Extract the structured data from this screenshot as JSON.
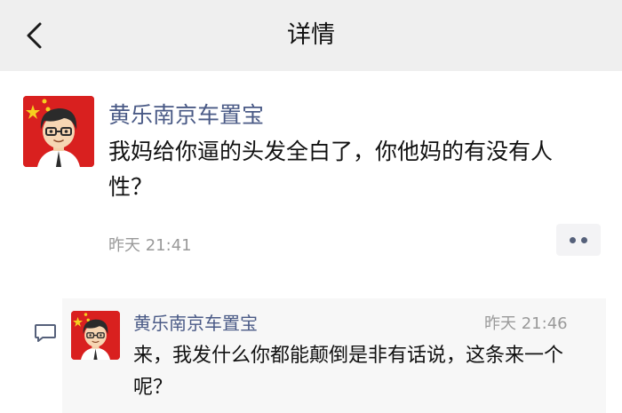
{
  "header": {
    "title": "详情",
    "back_icon": "chevron-left-icon"
  },
  "post": {
    "author": "黄乐南京车置宝",
    "text": "我妈给你逼的头发全白了，你他妈的有没有人性？",
    "time": "昨天 21:41",
    "more_icon": "more-dots-icon"
  },
  "comment": {
    "icon": "comment-icon",
    "author": "黄乐南京车置宝",
    "time": "昨天 21:46",
    "text": "来，我发什么你都能颠倒是非有话说，这条来一个呢？"
  },
  "colors": {
    "nav_bg": "#efefef",
    "author_name": "#4a5a86",
    "time_text": "#9a9a9a",
    "avatar_bg": "#d9201f",
    "comment_bg": "#f7f7f7"
  }
}
